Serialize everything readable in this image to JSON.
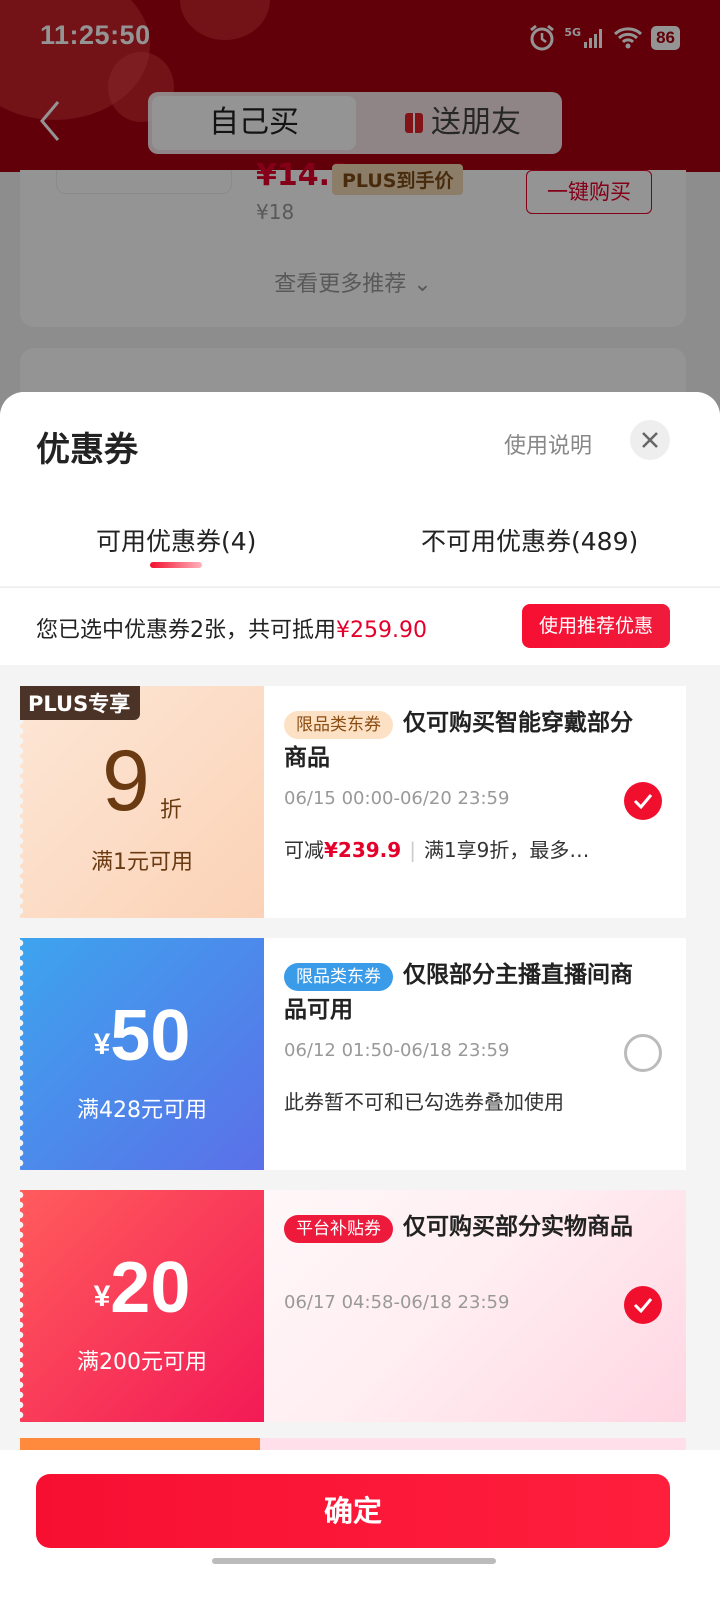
{
  "status_bar": {
    "time": "11:25:50",
    "network": "5G",
    "battery": "86"
  },
  "header": {
    "tab_self": "自己买",
    "tab_gift": "送朋友"
  },
  "background_card": {
    "price": "¥14.1",
    "plus_price_tag": "PLUS到手价",
    "old_price": "¥18",
    "buy_button": "一键购买",
    "more_recommend": "查看更多推荐 ⌄"
  },
  "sheet": {
    "title": "优惠券",
    "usage_link": "使用说明",
    "tabs": {
      "available": "可用优惠券(4)",
      "unavailable": "不可用优惠券(489)"
    },
    "selection": {
      "text": "您已选中优惠券2张，共可抵用",
      "amount": "¥259.90",
      "recommend_button": "使用推荐优惠"
    },
    "coupons": [
      {
        "badge": "PLUS专享",
        "value": "9",
        "unit": "折",
        "threshold": "满1元可用",
        "tag": "限品类东券",
        "title": "仅可购买智能穿戴部分商品",
        "date": "06/15 00:00-06/20 23:59",
        "note_prefix": "可减",
        "note_amount": "¥239.9",
        "note_rest": "满1享9折，最多…",
        "checked": true
      },
      {
        "currency": "¥",
        "value": "50",
        "threshold": "满428元可用",
        "tag": "限品类东券",
        "title": "仅限部分主播直播间商品可用",
        "date": "06/12 01:50-06/18 23:59",
        "note": "此券暂不可和已勾选券叠加使用",
        "checked": false
      },
      {
        "currency": "¥",
        "value": "20",
        "threshold": "满200元可用",
        "tag": "平台补贴券",
        "title": "仅可购买部分实物商品",
        "date": "06/17 04:58-06/18 23:59",
        "checked": true
      }
    ],
    "confirm_button": "确定"
  }
}
